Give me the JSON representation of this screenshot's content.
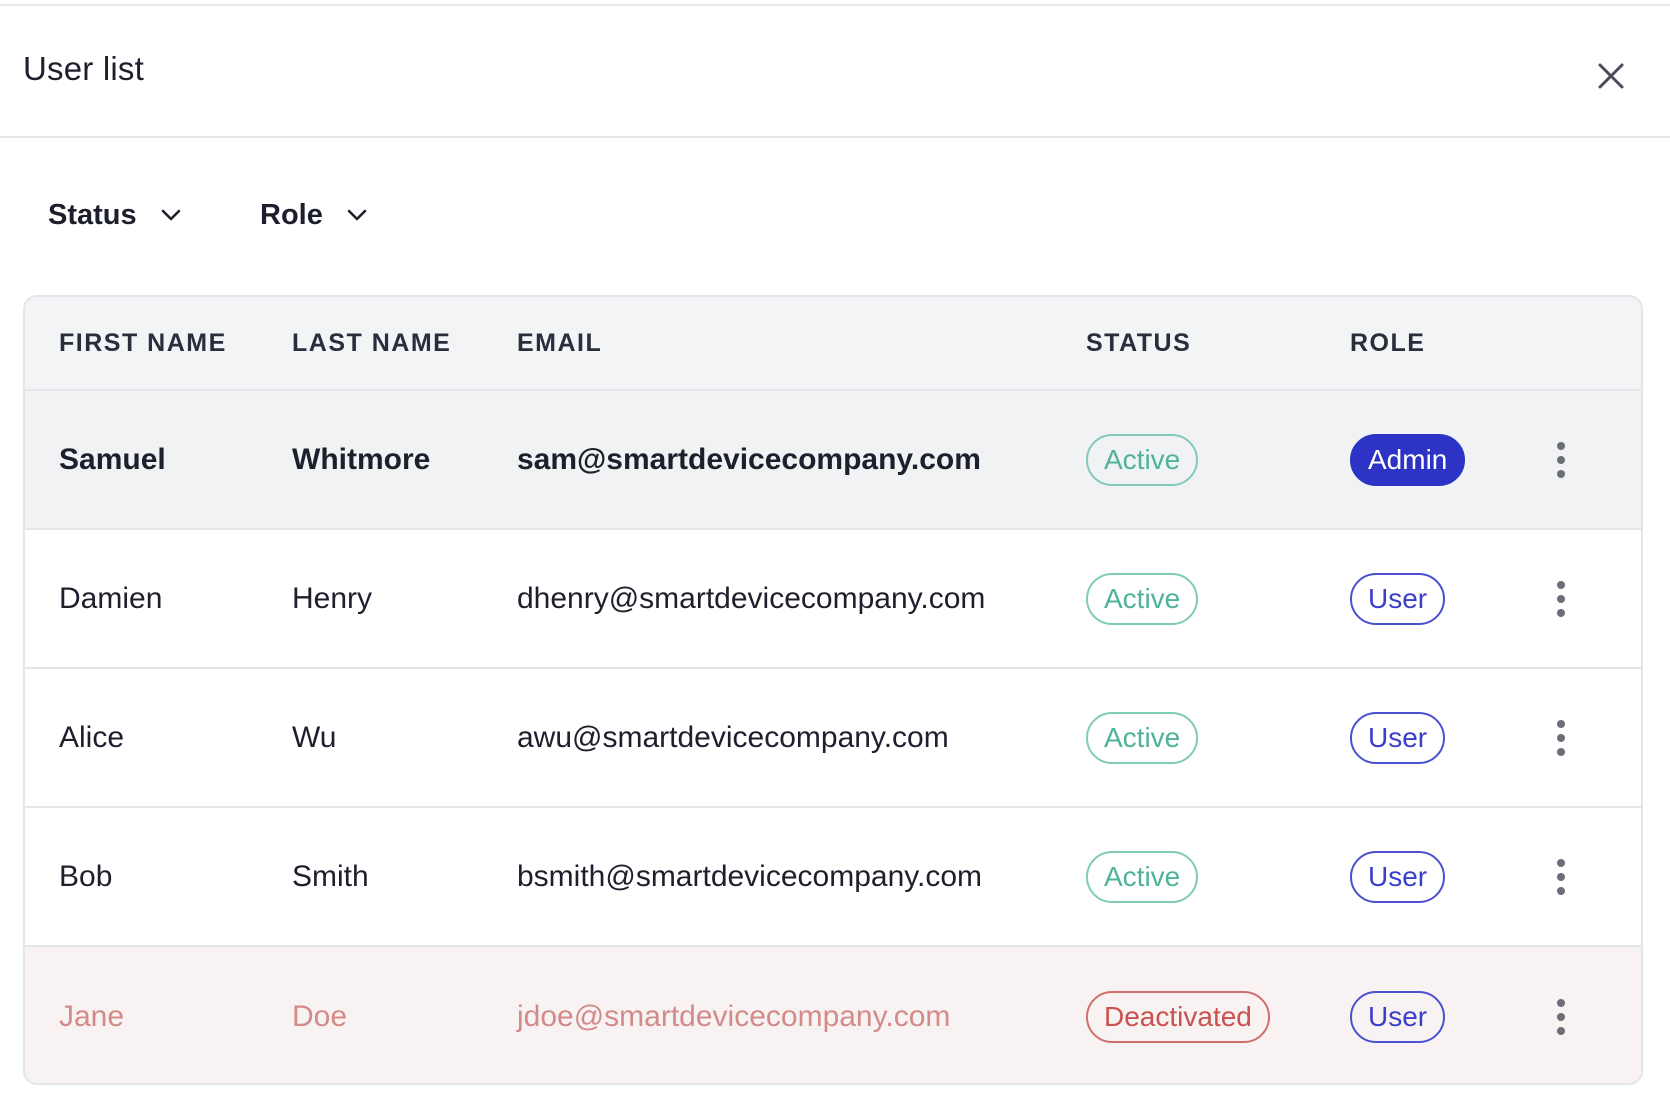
{
  "dialog": {
    "title": "User list",
    "close_icon": "close-icon"
  },
  "filters": [
    {
      "label": "Status",
      "icon": "chevron-down-icon"
    },
    {
      "label": "Role",
      "icon": "chevron-down-icon"
    }
  ],
  "table": {
    "columns": [
      "FIRST NAME",
      "LAST NAME",
      "EMAIL",
      "STATUS",
      "ROLE"
    ],
    "rows": [
      {
        "first": "Samuel",
        "last": "Whitmore",
        "email": "sam@smartdevicecompany.com",
        "status": "Active",
        "role": "Admin",
        "state": "selected"
      },
      {
        "first": "Damien",
        "last": "Henry",
        "email": "dhenry@smartdevicecompany.com",
        "status": "Active",
        "role": "User",
        "state": "normal"
      },
      {
        "first": "Alice",
        "last": "Wu",
        "email": "awu@smartdevicecompany.com",
        "status": "Active",
        "role": "User",
        "state": "normal"
      },
      {
        "first": "Bob",
        "last": "Smith",
        "email": "bsmith@smartdevicecompany.com",
        "status": "Active",
        "role": "User",
        "state": "normal"
      },
      {
        "first": "Jane",
        "last": "Doe",
        "email": "jdoe@smartdevicecompany.com",
        "status": "Deactivated",
        "role": "User",
        "state": "deactivated"
      }
    ],
    "row_action_icon": "more-vertical-icon"
  },
  "colors": {
    "active": "#4fb39a",
    "deactivated": "#c9514f",
    "role_accent": "#2d33c4",
    "header_bg": "#f3f4f6",
    "deactivated_row_bg": "#f8f3f2"
  }
}
